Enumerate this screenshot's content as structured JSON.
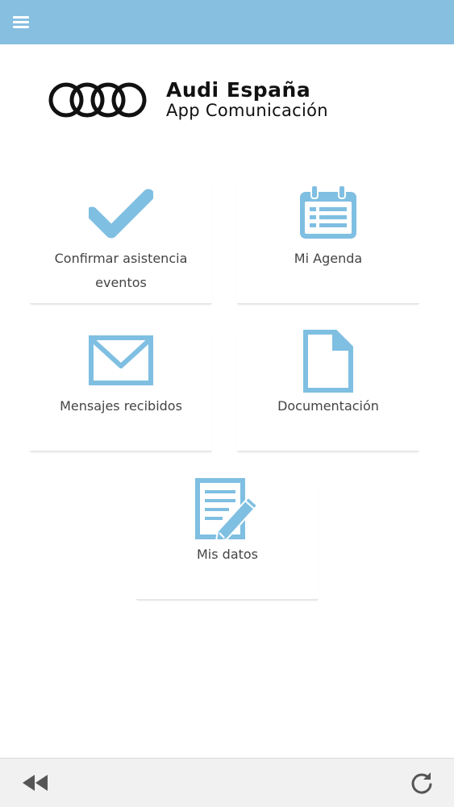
{
  "header": {
    "menu_icon": "hamburger-menu-icon",
    "color": "#86bfe0"
  },
  "logo": {
    "brand": "Audi España",
    "subtitle": "App Comunicación"
  },
  "tiles": [
    {
      "label": "Confirmar asistencia eventos",
      "icon": "checkmark-icon"
    },
    {
      "label": "Mi Agenda",
      "icon": "calendar-icon"
    },
    {
      "label": "Mensajes recibidos",
      "icon": "envelope-icon"
    },
    {
      "label": "Documentación",
      "icon": "document-icon"
    },
    {
      "label": "Mis datos",
      "icon": "edit-form-icon"
    }
  ],
  "footer": {
    "back_icon": "rewind-icon",
    "reload_icon": "reload-icon"
  },
  "colors": {
    "accent": "#86bfe0",
    "icon": "#7fbfe2",
    "text": "#444444"
  }
}
